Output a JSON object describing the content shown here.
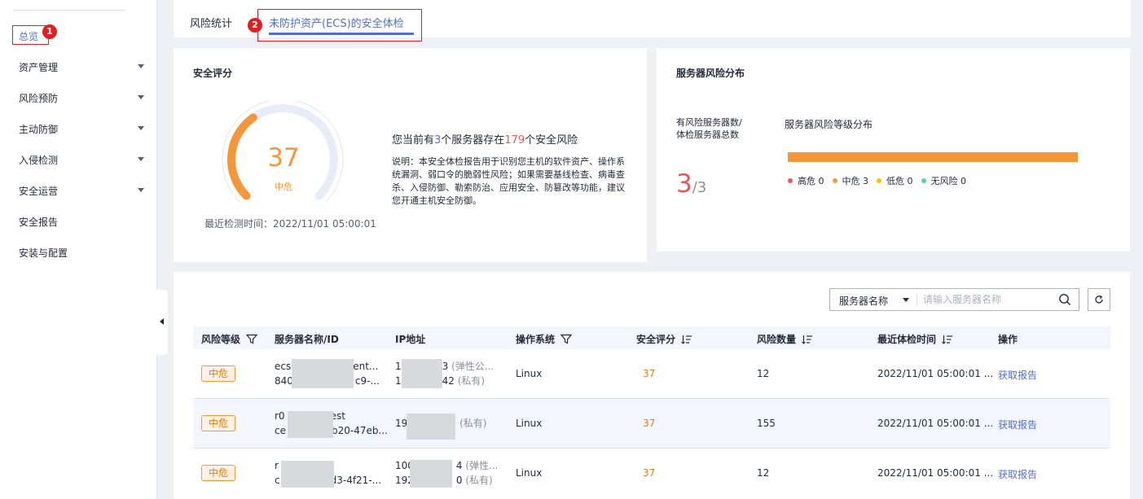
{
  "sidebar": {
    "items": [
      {
        "label": "总览",
        "active": true
      },
      {
        "label": "资产管理",
        "expandable": true
      },
      {
        "label": "风险预防",
        "expandable": true
      },
      {
        "label": "主动防御",
        "expandable": true
      },
      {
        "label": "入侵检测",
        "expandable": true
      },
      {
        "label": "安全运营",
        "expandable": true
      },
      {
        "label": "安全报告"
      },
      {
        "label": "安装与配置"
      }
    ]
  },
  "callouts": {
    "one": "1",
    "two": "2"
  },
  "tabs": [
    {
      "label": "风险统计"
    },
    {
      "label": "未防护资产(ECS)的安全体检",
      "active": true
    }
  ],
  "score_card": {
    "title": "安全评分",
    "score": "37",
    "level": "中危",
    "score_fraction": 0.37,
    "last_check": "最近检测时间：2022/11/01 05:00:01",
    "summary_prefix": "您当前有",
    "server_count": "3",
    "summary_mid": "个服务器存在",
    "risk_count": "179",
    "summary_suffix": "个安全风险",
    "description": "说明：本安全体检报告用于识别您主机的软件资产、操作系统漏洞、弱口令的脆弱性风险；如果需要基线检查、病毒查杀、入侵防御、勒索防治、应用安全、防篡改等功能，建议您开通主机安全防御。"
  },
  "server_card": {
    "title": "服务器风险分布",
    "count_label": "有风险服务器数/体检服务器总数",
    "risk_servers": "3",
    "total_servers": "/3",
    "dist_title": "服务器风险等级分布",
    "legend": [
      {
        "label": "高危 0",
        "color": "#e6565b"
      },
      {
        "label": "中危 3",
        "color": "#f5963a"
      },
      {
        "label": "低危 0",
        "color": "#f2c200"
      },
      {
        "label": "无风险 0",
        "color": "#50d4ab"
      }
    ]
  },
  "search": {
    "field": "服务器名称",
    "placeholder": "请输入服务器名称"
  },
  "table": {
    "headers": [
      "风险等级",
      "服务器名称/ID",
      "IP地址",
      "操作系统",
      "安全评分",
      "风险数量",
      "最近体检时间",
      "操作"
    ],
    "rows": [
      {
        "level": "中危",
        "name_l1_a": "ecs",
        "name_l1_b": "ent...",
        "name_l2_a": "840",
        "name_l2_b": "c9-...",
        "ip_l1_a": "1",
        "ip_l1_b": "3",
        "ip_l1_note": "(弹性公...",
        "ip_l2_a": "1",
        "ip_l2_b": "42",
        "ip_l2_note": "(私有)",
        "os": "Linux",
        "score": "37",
        "risks": "12",
        "time": "2022/11/01 05:00:01 ...",
        "action": "获取报告"
      },
      {
        "level": "中危",
        "name_l1_a": "r0",
        "name_l1_b": "est",
        "name_l2_a": "ce",
        "name_l2_b": "b20-47eb...",
        "ip_l1_a": "19",
        "ip_l1_note": "(私有)",
        "os": "Linux",
        "score": "37",
        "risks": "155",
        "time": "2022/11/01 05:00:01 ...",
        "action": "获取报告"
      },
      {
        "level": "中危",
        "name_l1_a": "r",
        "name_l2_a": "c",
        "name_l2_b": "d3-4f21-...",
        "ip_l1_a": "100",
        "ip_l1_b": "4",
        "ip_l1_note": "(弹性...",
        "ip_l2_a": "192",
        "ip_l2_b": "0",
        "ip_l2_note": "(私有)",
        "os": "Linux",
        "score": "37",
        "risks": "12",
        "time": "2022/11/01 05:00:01 ...",
        "action": "获取报告"
      }
    ]
  }
}
